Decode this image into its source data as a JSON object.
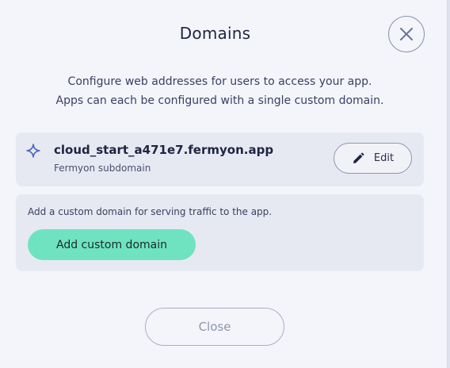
{
  "modal": {
    "title": "Domains",
    "description": [
      "Configure web addresses for users to access your app.",
      "Apps can each be configured with a single custom domain."
    ],
    "close_icon": "close-icon"
  },
  "subdomain": {
    "icon": "sparkle-icon",
    "name": "cloud_start_a471e7.fermyon.app",
    "label": "Fermyon subdomain",
    "edit_icon": "pencil-icon",
    "edit_label": "Edit"
  },
  "custom_domain": {
    "hint": "Add a custom domain for serving traffic to the app.",
    "button_label": "Add custom domain"
  },
  "footer": {
    "close_label": "Close"
  },
  "colors": {
    "accent": "#6fe3bf",
    "sparkle": "#4a63c8",
    "text": "#1f2440"
  }
}
